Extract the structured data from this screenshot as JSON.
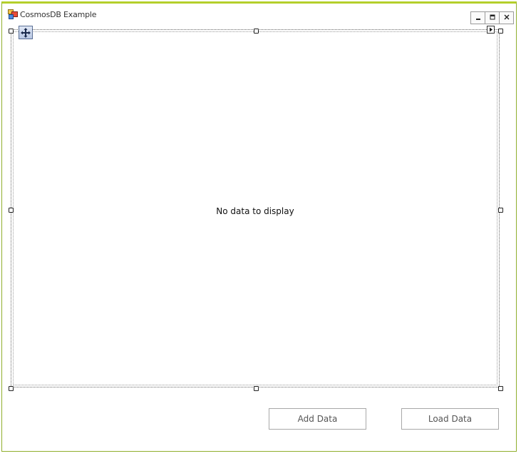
{
  "window": {
    "title": "CosmosDB Example",
    "icon": "app-window-icon",
    "controls": {
      "minimize_icon": "minimize-icon",
      "maximize_icon": "maximize-icon",
      "close_icon": "close-icon"
    }
  },
  "grid": {
    "empty_message": "No data to display",
    "move_icon": "move-arrows-icon",
    "smart_tag_icon": "smart-tag-arrow-icon"
  },
  "buttons": {
    "add_label": "Add Data",
    "load_label": "Load Data"
  },
  "colors": {
    "window_border": "#b4cf2a",
    "button_text": "#555555"
  }
}
